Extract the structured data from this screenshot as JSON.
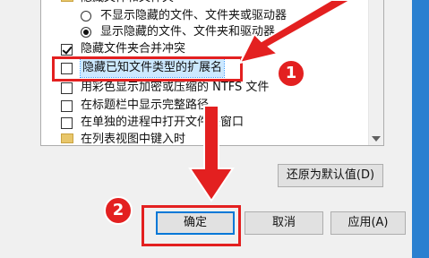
{
  "options": {
    "radio_hidden": "不显示隐藏的文件、文件夹或驱动器",
    "radio_show": "显示隐藏的文件、文件夹和驱动器",
    "merge_conflict": "隐藏文件夹合并冲突",
    "hide_extensions": "隐藏已知文件类型的扩展名",
    "color_ntfs": "用彩色显示加密或压缩的 NTFS 文件",
    "full_path": "在标题栏中显示完整路径",
    "separate_process": "在单独的进程中打开文件夹窗口",
    "preview_handlers": "在列表视图中键入时"
  },
  "buttons": {
    "restore_defaults": "还原为默认值(D)",
    "ok": "确定",
    "cancel": "取消",
    "apply": "应用(A)"
  },
  "annotations": {
    "step1": "1",
    "step2": "2"
  },
  "colors": {
    "accent_red": "#e32020",
    "selection": "#cce8ff"
  }
}
